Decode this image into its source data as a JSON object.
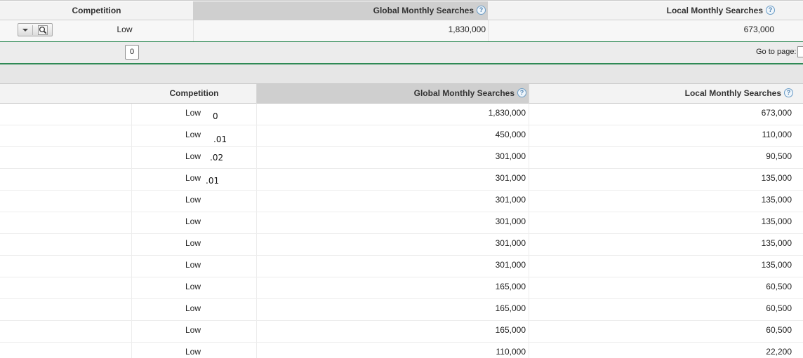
{
  "top_table": {
    "headers": {
      "competition": "Competition",
      "global": "Global Monthly Searches",
      "local": "Local Monthly Searches"
    },
    "row": {
      "competition": "Low",
      "global": "1,830,000",
      "local": "673,000"
    }
  },
  "pager": {
    "page": "0",
    "goto_label": "Go to page:"
  },
  "main_table": {
    "headers": {
      "competition": "Competition",
      "global": "Global Monthly Searches",
      "local": "Local Monthly Searches"
    },
    "rows": [
      {
        "competition": "Low",
        "global": "1,830,000",
        "local": "673,000"
      },
      {
        "competition": "Low",
        "global": "450,000",
        "local": "110,000"
      },
      {
        "competition": "Low",
        "global": "301,000",
        "local": "90,500"
      },
      {
        "competition": "Low",
        "global": "301,000",
        "local": "135,000"
      },
      {
        "competition": "Low",
        "global": "301,000",
        "local": "135,000"
      },
      {
        "competition": "Low",
        "global": "301,000",
        "local": "135,000"
      },
      {
        "competition": "Low",
        "global": "301,000",
        "local": "135,000"
      },
      {
        "competition": "Low",
        "global": "301,000",
        "local": "135,000"
      },
      {
        "competition": "Low",
        "global": "165,000",
        "local": "60,500"
      },
      {
        "competition": "Low",
        "global": "165,000",
        "local": "60,500"
      },
      {
        "competition": "Low",
        "global": "165,000",
        "local": "60,500"
      },
      {
        "competition": "Low",
        "global": "110,000",
        "local": "22,200"
      }
    ],
    "annotations": [
      "0",
      ".01",
      ".02",
      ".01"
    ]
  },
  "icons": {
    "help": "help-icon",
    "dropdown": "chevron-down-icon",
    "magnifier": "magnifier-icon"
  },
  "colors": {
    "accent_green": "#2f8a55",
    "sorted_header": "#cfcfcf",
    "help_blue": "#4a7fb0"
  }
}
